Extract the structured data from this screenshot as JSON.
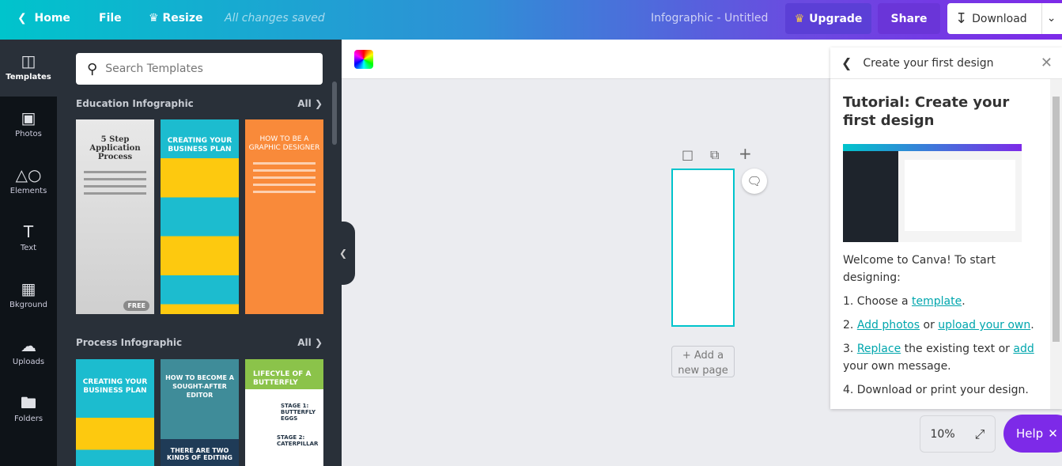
{
  "topbar": {
    "home": "Home",
    "file": "File",
    "resize": "Resize",
    "saved_status": "All changes saved",
    "doc_title": "Infographic - Untitled",
    "upgrade": "Upgrade",
    "share": "Share",
    "download": "Download"
  },
  "rail": [
    {
      "label": "Templates",
      "icon": "template-icon"
    },
    {
      "label": "Photos",
      "icon": "photo-icon"
    },
    {
      "label": "Elements",
      "icon": "elements-icon"
    },
    {
      "label": "Text",
      "icon": "text-icon"
    },
    {
      "label": "Bkground",
      "icon": "background-icon"
    },
    {
      "label": "Uploads",
      "icon": "upload-icon"
    },
    {
      "label": "Folders",
      "icon": "folder-icon"
    }
  ],
  "panel": {
    "search_placeholder": "Search Templates",
    "sections": [
      {
        "title": "Education Infographic",
        "all": "All",
        "templates": [
          {
            "title": "5 Step Application Process",
            "badge": "FREE"
          },
          {
            "title": "CREATING YOUR BUSINESS PLAN"
          },
          {
            "title": "HOW TO BE A GRAPHIC DESIGNER"
          }
        ]
      },
      {
        "title": "Process Infographic",
        "all": "All",
        "templates": [
          {
            "title": "CREATING YOUR BUSINESS PLAN"
          },
          {
            "title": "HOW TO BECOME A SOUGHT-AFTER EDITOR",
            "footer": "THERE ARE TWO KINDS OF EDITING"
          },
          {
            "title": "LIFECYLE OF A BUTTERFLY",
            "stage1": "STAGE 1: BUTTERFLY EGGS",
            "stage2": "STAGE 2: CATERPILLAR"
          }
        ]
      }
    ]
  },
  "canvas": {
    "add_page": "+ Add a new page",
    "zoom": "10%"
  },
  "tutorial": {
    "header": "Create your first design",
    "title": "Tutorial: Create your first design",
    "intro": "Welcome to Canva! To start designing:",
    "step1_pre": "1. Choose a ",
    "step1_link": "template",
    "step1_post": ".",
    "step2_pre": "2. ",
    "step2_link1": "Add photos",
    "step2_mid": " or ",
    "step2_link2": "upload your own",
    "step2_post": ".",
    "step3_pre": "3. ",
    "step3_link1": "Replace",
    "step3_mid": " the existing text or ",
    "step3_link2": "add",
    "step3_post": " your own message.",
    "step4": "4. Download or print your design."
  },
  "help": "Help",
  "colors": {
    "accent": "#00c4cc",
    "purple": "#7d2ae8",
    "panel": "#293039"
  }
}
